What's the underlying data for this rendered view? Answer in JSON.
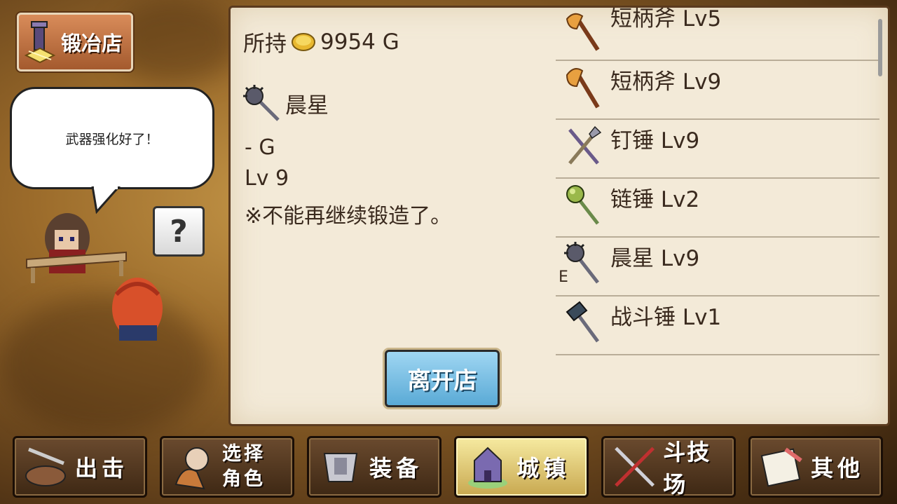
{
  "shop": {
    "title": "锻冶店"
  },
  "dialog": {
    "text": "武器强化好了！",
    "help": "?"
  },
  "gold": {
    "label": "所持",
    "amount": "9954 G"
  },
  "selected": {
    "name": "晨星",
    "price": " - G",
    "level": "Lv 9",
    "note": "※不能再继续锻造了。"
  },
  "leave_button": "离开店",
  "items": [
    {
      "name": "短柄斧 Lv5",
      "icon": "axe-icon",
      "equipped": ""
    },
    {
      "name": "短柄斧 Lv9",
      "icon": "axe-icon",
      "equipped": ""
    },
    {
      "name": "钉锤 Lv9",
      "icon": "spiked-hammer-icon",
      "equipped": ""
    },
    {
      "name": "链锤 Lv2",
      "icon": "flail-icon",
      "equipped": ""
    },
    {
      "name": "晨星 Lv9",
      "icon": "morning-star-icon",
      "equipped": "E"
    },
    {
      "name": "战斗锤 Lv1",
      "icon": "war-hammer-icon",
      "equipped": ""
    }
  ],
  "nav": [
    {
      "label": "出击",
      "icon": "sortie-icon"
    },
    {
      "label": "选择角色",
      "label_l1": "选择",
      "label_l2": "角色",
      "icon": "character-icon"
    },
    {
      "label": "装备",
      "icon": "armor-icon"
    },
    {
      "label": "城镇",
      "icon": "town-icon",
      "active": true
    },
    {
      "label": "斗技场",
      "icon": "arena-icon"
    },
    {
      "label": "其他",
      "icon": "scroll-icon"
    }
  ],
  "colors": {
    "panel_bg": "#f3ead8",
    "text": "#3a2a1e",
    "leave_btn": "#6ab8e0",
    "active_nav": "#e8d68a"
  }
}
